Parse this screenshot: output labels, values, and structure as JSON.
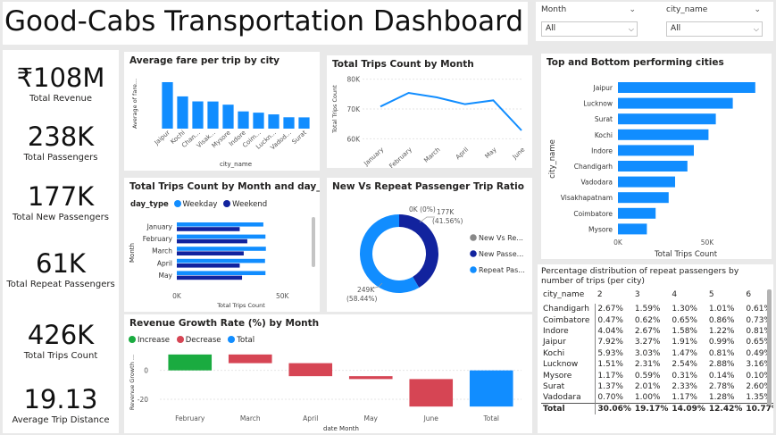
{
  "header": {
    "title": "Good-Cabs Transportation Dashboard"
  },
  "slicers": {
    "month": {
      "label": "Month",
      "value": "All"
    },
    "city": {
      "label": "city_name",
      "value": "All"
    }
  },
  "kpis": [
    {
      "value": "₹108M",
      "label": "Total Revenue"
    },
    {
      "value": "238K",
      "label": "Total Passengers"
    },
    {
      "value": "177K",
      "label": "Total New Passengers"
    },
    {
      "value": "61K",
      "label": "Total Repeat Passengers"
    },
    {
      "value": "426K",
      "label": "Total Trips Count"
    },
    {
      "value": "19.13",
      "label": "Average Trip Distance"
    }
  ],
  "colors": {
    "bar": "#118dff",
    "dark": "#12239e",
    "green": "#1aab40",
    "red": "#d64554",
    "grey": "#888888"
  },
  "chart_data": [
    {
      "id": "avg-fare",
      "type": "bar",
      "title": "Average fare per trip by city",
      "xlabel": "city_name",
      "ylabel": "Average of fare...",
      "categories": [
        "Jaipur",
        "Kochi",
        "Chan...",
        "Visak...",
        "Mysore",
        "Indore",
        "Coim...",
        "Luckn...",
        "Vadod...",
        "Surat"
      ],
      "values": [
        483,
        335,
        283,
        282,
        249,
        179,
        166,
        148,
        118,
        117
      ],
      "ylim": [
        0,
        520
      ]
    },
    {
      "id": "trips-month",
      "type": "line",
      "title": "Total Trips Count by Month",
      "ylabel": "Total Trips Count",
      "categories": [
        "January",
        "February",
        "March",
        "April",
        "May",
        "June"
      ],
      "values": [
        70800,
        75400,
        73900,
        71600,
        72900,
        62800
      ],
      "yticks": [
        "60K",
        "70K",
        "80K"
      ],
      "ylim": [
        58000,
        82000
      ]
    },
    {
      "id": "top-bottom",
      "type": "bar",
      "orientation": "horizontal",
      "title": "Top and Bottom performing cities",
      "ylabel": "city_name",
      "xlabel": "Total Trips Count",
      "categories": [
        "Jaipur",
        "Lucknow",
        "Surat",
        "Kochi",
        "Indore",
        "Chandigarh",
        "Vadodara",
        "Visakhapatnam",
        "Coimbatore",
        "Mysore"
      ],
      "values": [
        76900,
        64300,
        54800,
        50700,
        42500,
        38900,
        32000,
        28400,
        21100,
        16200
      ],
      "xticks": [
        "0K",
        "50K"
      ],
      "xlim": [
        0,
        80000
      ]
    },
    {
      "id": "trips-daytype",
      "type": "bar",
      "orientation": "horizontal",
      "title": "Total Trips Count by Month and day_type",
      "legend_title": "day_type",
      "xlabel": "Total Trips Count",
      "ylabel": "Month",
      "categories": [
        "January",
        "February",
        "March",
        "April",
        "May"
      ],
      "series": [
        {
          "name": "Weekday",
          "values": [
            41000,
            42000,
            42200,
            41800,
            42000
          ]
        },
        {
          "name": "Weekend",
          "values": [
            29800,
            33400,
            31700,
            29800,
            30900
          ]
        }
      ],
      "xticks": [
        "0K",
        "50K"
      ],
      "xlim": [
        0,
        55000
      ]
    },
    {
      "id": "new-repeat",
      "type": "pie",
      "title": "New Vs Repeat Passenger Trip Ratio",
      "labels": [
        "New Vs Re...",
        "New Passe...",
        "Repeat Pas..."
      ],
      "values": [
        0,
        177,
        249
      ],
      "data_labels": [
        {
          "value": "0K (0%)",
          "pct": ""
        },
        {
          "value": "177K",
          "pct": "(41.56%)"
        },
        {
          "value": "249K",
          "pct": "(58.44%)"
        }
      ]
    },
    {
      "id": "rev-growth",
      "type": "waterfall",
      "title": "Revenue Growth Rate (%) by Month",
      "xlabel": "date Month",
      "ylabel": "Revenue Growth ...",
      "legend": [
        "Increase",
        "Decrease",
        "Total"
      ],
      "categories": [
        "February",
        "March",
        "April",
        "May",
        "June",
        "Total"
      ],
      "values": [
        11,
        -6,
        -9,
        -2,
        -19,
        -25
      ],
      "yticks": [
        0,
        -20
      ],
      "ylim": [
        -28,
        14
      ]
    }
  ],
  "repeat_table": {
    "title": "Percentage distribution of repeat passengers by number of trips (per city)",
    "columns": [
      "city_name",
      "2",
      "3",
      "4",
      "5",
      "6"
    ],
    "rows": [
      [
        "Chandigarh",
        "2.67%",
        "1.59%",
        "1.30%",
        "1.01%",
        "0.61%"
      ],
      [
        "Coimbatore",
        "0.47%",
        "0.62%",
        "0.65%",
        "0.86%",
        "0.73%"
      ],
      [
        "Indore",
        "4.04%",
        "2.67%",
        "1.58%",
        "1.22%",
        "0.81%"
      ],
      [
        "Jaipur",
        "7.92%",
        "3.27%",
        "1.91%",
        "0.99%",
        "0.65%"
      ],
      [
        "Kochi",
        "5.93%",
        "3.03%",
        "1.47%",
        "0.81%",
        "0.49%"
      ],
      [
        "Lucknow",
        "1.51%",
        "2.31%",
        "2.54%",
        "2.88%",
        "3.16%"
      ],
      [
        "Mysore",
        "1.17%",
        "0.59%",
        "0.31%",
        "0.14%",
        "0.10%"
      ],
      [
        "Surat",
        "1.37%",
        "2.01%",
        "2.33%",
        "2.78%",
        "2.60%"
      ],
      [
        "Vadodara",
        "0.70%",
        "1.00%",
        "1.17%",
        "1.28%",
        "1.35%"
      ]
    ],
    "total": [
      "Total",
      "30.06%",
      "19.17%",
      "14.09%",
      "12.42%",
      "10.77%"
    ]
  }
}
